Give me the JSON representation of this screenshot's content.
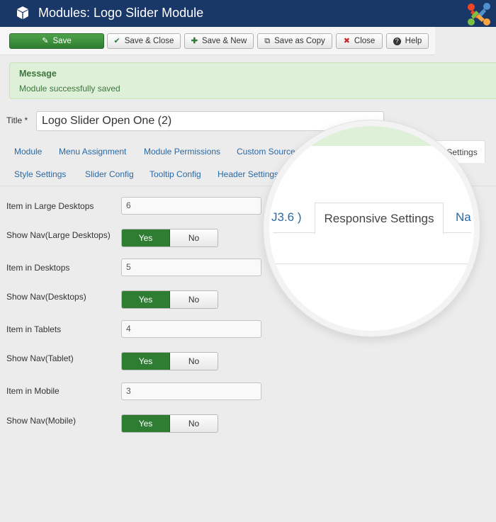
{
  "header": {
    "title": "Modules: Logo Slider Module",
    "bg_color": "#1a3867"
  },
  "toolbar": {
    "save": "Save",
    "save_close": "Save & Close",
    "save_new": "Save & New",
    "save_copy": "Save as Copy",
    "close": "Close",
    "help": "Help"
  },
  "message": {
    "heading": "Message",
    "body": "Module successfully saved"
  },
  "title_field": {
    "label": "Title *",
    "value": "Logo Slider Open One (2)"
  },
  "tabs": {
    "row1": [
      "Module",
      "Menu Assignment",
      "Module Permissions",
      "Custom Source",
      "nsive Settings"
    ],
    "row2": [
      "Style Settings",
      "Slider Config",
      "Tooltip Config",
      "Header Settings"
    ]
  },
  "magnifier": {
    "left_fragment": "J3.6 )",
    "active_tab": "Responsive Settings",
    "right_fragment": "Na"
  },
  "form": {
    "rows": [
      {
        "label": "Item in Large Desktops",
        "value": "6"
      },
      {
        "label": "Show Nav(Large Desktops)",
        "yes": "Yes",
        "no": "No",
        "selected": "Yes"
      },
      {
        "label": "Item in Desktops",
        "value": "5"
      },
      {
        "label": "Show Nav(Desktops)",
        "yes": "Yes",
        "no": "No",
        "selected": "Yes"
      },
      {
        "label": "Item in Tablets",
        "value": "4"
      },
      {
        "label": "Show Nav(Tablet)",
        "yes": "Yes",
        "no": "No",
        "selected": "Yes"
      },
      {
        "label": "Item in Mobile",
        "value": "3"
      },
      {
        "label": "Show Nav(Mobile)",
        "yes": "Yes",
        "no": "No",
        "selected": "Yes"
      }
    ]
  },
  "colors": {
    "accent_green": "#2e7d32",
    "link_blue": "#2a69a4",
    "message_bg": "#dff0d8"
  }
}
